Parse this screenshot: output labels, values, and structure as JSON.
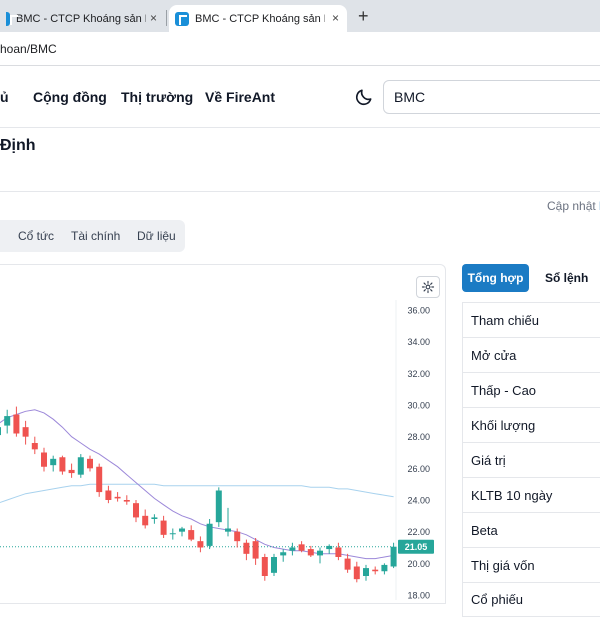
{
  "browser": {
    "tab1_title": "BMC - CTCP Khoáng sản Bình Đ",
    "tab2_title": "BMC - CTCP Khoáng sản Bình Đ",
    "close_glyph": "×",
    "newtab_glyph": "+",
    "url": "hoan/BMC"
  },
  "nav": {
    "items": [
      "ủ",
      "Cộng đồng",
      "Thị trường",
      "Về FireAnt"
    ],
    "search_value": "BMC"
  },
  "company_name": "Định",
  "updated_label": "Cập nhật",
  "subtabs": [
    "Cổ tức",
    "Tài chính",
    "Dữ liệu"
  ],
  "right_panel": {
    "tab_active": "Tổng hợp",
    "tab_other": "Sổ lệnh",
    "rows": [
      "Tham chiếu",
      "Mở cửa",
      "Thấp - Cao",
      "Khối lượng",
      "Giá trị",
      "KLTB 10 ngày",
      "Beta",
      "Thị giá vốn",
      "Cổ phiếu"
    ]
  },
  "colors": {
    "up": "#26a69a",
    "down": "#ef5350",
    "ma_short": "#9c88d9",
    "ma_long": "#a8d2ee",
    "accent": "#1b7bc4"
  },
  "chart_data": {
    "type": "candlestick",
    "y_ticks": [
      "36.00",
      "34.00",
      "32.00",
      "30.00",
      "28.00",
      "26.00",
      "24.00",
      "22.00",
      "20.00",
      "18.00"
    ],
    "ylim": [
      18,
      36
    ],
    "current_price": "21.05",
    "current_price_value": 21.05,
    "candles": [
      {
        "o": 28.1,
        "h": 29.1,
        "l": 27.6,
        "c": 28.6
      },
      {
        "o": 28.7,
        "h": 29.7,
        "l": 28.2,
        "c": 29.3
      },
      {
        "o": 29.4,
        "h": 29.9,
        "l": 28.0,
        "c": 28.2
      },
      {
        "o": 28.6,
        "h": 29.0,
        "l": 27.5,
        "c": 28.0
      },
      {
        "o": 27.6,
        "h": 28.0,
        "l": 26.9,
        "c": 27.2
      },
      {
        "o": 27.0,
        "h": 27.3,
        "l": 25.8,
        "c": 26.1
      },
      {
        "o": 26.2,
        "h": 26.8,
        "l": 25.8,
        "c": 26.6
      },
      {
        "o": 26.7,
        "h": 26.8,
        "l": 25.6,
        "c": 25.8
      },
      {
        "o": 25.9,
        "h": 26.3,
        "l": 25.4,
        "c": 25.7
      },
      {
        "o": 25.6,
        "h": 26.9,
        "l": 25.4,
        "c": 26.7
      },
      {
        "o": 26.6,
        "h": 26.8,
        "l": 25.8,
        "c": 26.0
      },
      {
        "o": 26.1,
        "h": 26.3,
        "l": 24.2,
        "c": 24.5
      },
      {
        "o": 24.6,
        "h": 24.9,
        "l": 23.8,
        "c": 24.0
      },
      {
        "o": 24.2,
        "h": 24.5,
        "l": 23.9,
        "c": 24.1
      },
      {
        "o": 24.0,
        "h": 24.3,
        "l": 23.7,
        "c": 23.9
      },
      {
        "o": 23.8,
        "h": 24.0,
        "l": 22.6,
        "c": 22.9
      },
      {
        "o": 23.0,
        "h": 23.4,
        "l": 22.2,
        "c": 22.4
      },
      {
        "o": 22.8,
        "h": 23.1,
        "l": 22.5,
        "c": 22.9
      },
      {
        "o": 22.7,
        "h": 23.0,
        "l": 21.6,
        "c": 21.8
      },
      {
        "o": 21.9,
        "h": 22.2,
        "l": 21.5,
        "c": 21.9
      },
      {
        "o": 22.0,
        "h": 22.3,
        "l": 21.7,
        "c": 22.2
      },
      {
        "o": 22.1,
        "h": 22.4,
        "l": 21.4,
        "c": 21.5
      },
      {
        "o": 21.4,
        "h": 21.7,
        "l": 20.7,
        "c": 21.0
      },
      {
        "o": 21.1,
        "h": 22.8,
        "l": 20.9,
        "c": 22.5
      },
      {
        "o": 22.6,
        "h": 24.8,
        "l": 22.3,
        "c": 24.6
      },
      {
        "o": 22.0,
        "h": 23.5,
        "l": 21.7,
        "c": 22.2
      },
      {
        "o": 22.0,
        "h": 22.2,
        "l": 21.0,
        "c": 21.4
      },
      {
        "o": 21.3,
        "h": 21.5,
        "l": 20.2,
        "c": 20.6
      },
      {
        "o": 21.4,
        "h": 21.6,
        "l": 19.9,
        "c": 20.3
      },
      {
        "o": 20.4,
        "h": 20.6,
        "l": 18.9,
        "c": 19.2
      },
      {
        "o": 19.4,
        "h": 20.6,
        "l": 19.2,
        "c": 20.4
      },
      {
        "o": 20.5,
        "h": 20.9,
        "l": 20.1,
        "c": 20.7
      },
      {
        "o": 20.8,
        "h": 21.3,
        "l": 20.5,
        "c": 21.0
      },
      {
        "o": 21.2,
        "h": 21.4,
        "l": 20.7,
        "c": 20.8
      },
      {
        "o": 20.9,
        "h": 21.1,
        "l": 20.4,
        "c": 20.5
      },
      {
        "o": 20.5,
        "h": 21.0,
        "l": 20.0,
        "c": 20.8
      },
      {
        "o": 20.9,
        "h": 21.2,
        "l": 20.6,
        "c": 21.1
      },
      {
        "o": 21.0,
        "h": 21.3,
        "l": 20.2,
        "c": 20.4
      },
      {
        "o": 20.3,
        "h": 20.6,
        "l": 19.4,
        "c": 19.6
      },
      {
        "o": 19.8,
        "h": 20.1,
        "l": 18.8,
        "c": 19.0
      },
      {
        "o": 19.2,
        "h": 19.9,
        "l": 18.9,
        "c": 19.7
      },
      {
        "o": 19.6,
        "h": 19.8,
        "l": 19.3,
        "c": 19.5
      },
      {
        "o": 19.5,
        "h": 20.0,
        "l": 19.3,
        "c": 19.9
      },
      {
        "o": 19.8,
        "h": 21.3,
        "l": 19.7,
        "c": 21.05
      }
    ],
    "ma_short": [
      28.8,
      29.2,
      29.4,
      29.6,
      29.7,
      29.5,
      29.1,
      28.6,
      28.0,
      27.6,
      27.2,
      26.9,
      26.5,
      26.1,
      25.6,
      25.1,
      24.6,
      24.1,
      23.7,
      23.3,
      23.0,
      22.8,
      22.5,
      22.3,
      22.2,
      22.1,
      22.0,
      21.8,
      21.5,
      21.2,
      21.0,
      20.9,
      20.8,
      20.8,
      20.7,
      20.6,
      20.6,
      20.6,
      20.5,
      20.4,
      20.3,
      20.3,
      20.4,
      20.5
    ],
    "ma_long": [
      23.8,
      24.0,
      24.2,
      24.4,
      24.5,
      24.6,
      24.7,
      24.8,
      24.9,
      24.9,
      25.0,
      25.0,
      25.0,
      25.0,
      25.0,
      25.0,
      25.0,
      25.0,
      24.9,
      24.9,
      24.9,
      24.9,
      24.9,
      24.9,
      24.9,
      24.9,
      24.9,
      24.9,
      24.9,
      24.9,
      24.9,
      24.9,
      24.9,
      24.9,
      24.8,
      24.8,
      24.8,
      24.7,
      24.7,
      24.6,
      24.5,
      24.4,
      24.3,
      24.2
    ]
  }
}
